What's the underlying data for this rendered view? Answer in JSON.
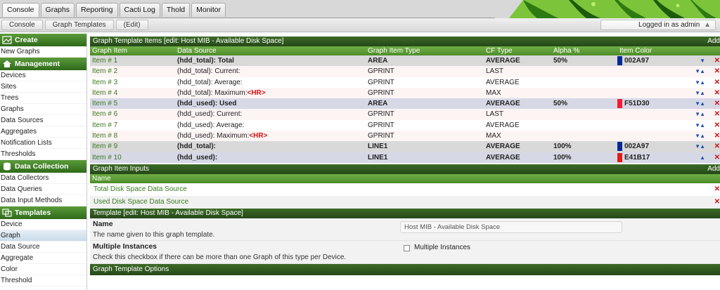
{
  "tabs": [
    "Console",
    "Graphs",
    "Reporting",
    "Cacti Log",
    "Thold",
    "Monitor"
  ],
  "breadcrumbs": [
    "Console",
    "Graph Templates",
    "(Edit)"
  ],
  "login_status": "Logged in as admin",
  "sidebar": {
    "create": {
      "label": "Create",
      "items": [
        "New Graphs"
      ]
    },
    "management": {
      "label": "Management",
      "items": [
        "Devices",
        "Sites",
        "Trees",
        "Graphs",
        "Data Sources",
        "Aggregates",
        "Notification Lists",
        "Thresholds"
      ]
    },
    "data_collection": {
      "label": "Data Collection",
      "items": [
        "Data Collectors",
        "Data Queries",
        "Data Input Methods"
      ]
    },
    "templates": {
      "label": "Templates",
      "items": [
        "Device",
        "Graph",
        "Data Source",
        "Aggregate",
        "Color",
        "Threshold"
      ],
      "selected": "Graph"
    }
  },
  "items_section": {
    "title": "Graph Template Items [edit: Host MIB - Available Disk Space]",
    "add_label": "Add",
    "columns": [
      "Graph Item",
      "Data Source",
      "Graph Item Type",
      "CF Type",
      "Alpha %",
      "Item Color"
    ],
    "rows": [
      {
        "name": "Item # 1",
        "ds": "(hdd_total): Total",
        "hr": "",
        "type": "AREA",
        "cf": "AVERAGE",
        "alpha": "50%",
        "color": "002A97",
        "hex": "#002A97",
        "arrows": "▼",
        "bold": true,
        "style": "hl2"
      },
      {
        "name": "Item # 2",
        "ds": "(hdd_total): Current:",
        "hr": "",
        "type": "GPRINT",
        "cf": "LAST",
        "alpha": "",
        "color": "",
        "hex": "",
        "arrows": "▼▲",
        "bold": false,
        "style": "even"
      },
      {
        "name": "Item # 3",
        "ds": "(hdd_total): Average:",
        "hr": "",
        "type": "GPRINT",
        "cf": "AVERAGE",
        "alpha": "",
        "color": "",
        "hex": "",
        "arrows": "▼▲",
        "bold": false,
        "style": "odd"
      },
      {
        "name": "Item # 4",
        "ds": "(hdd_total): Maximum:",
        "hr": "<HR>",
        "type": "GPRINT",
        "cf": "MAX",
        "alpha": "",
        "color": "",
        "hex": "",
        "arrows": "▼▲",
        "bold": false,
        "style": "even"
      },
      {
        "name": "Item # 5",
        "ds": "(hdd_used): Used",
        "hr": "",
        "type": "AREA",
        "cf": "AVERAGE",
        "alpha": "50%",
        "color": "F51D30",
        "hex": "#F51D30",
        "arrows": "▼▲",
        "bold": true,
        "style": "hl"
      },
      {
        "name": "Item # 6",
        "ds": "(hdd_used): Current:",
        "hr": "",
        "type": "GPRINT",
        "cf": "LAST",
        "alpha": "",
        "color": "",
        "hex": "",
        "arrows": "▼▲",
        "bold": false,
        "style": "even"
      },
      {
        "name": "Item # 7",
        "ds": "(hdd_used): Average:",
        "hr": "",
        "type": "GPRINT",
        "cf": "AVERAGE",
        "alpha": "",
        "color": "",
        "hex": "",
        "arrows": "▼▲",
        "bold": false,
        "style": "odd"
      },
      {
        "name": "Item # 8",
        "ds": "(hdd_used): Maximum:",
        "hr": "<HR>",
        "type": "GPRINT",
        "cf": "MAX",
        "alpha": "",
        "color": "",
        "hex": "",
        "arrows": "▼▲",
        "bold": false,
        "style": "even"
      },
      {
        "name": "Item # 9",
        "ds": "(hdd_total):",
        "hr": "",
        "type": "LINE1",
        "cf": "AVERAGE",
        "alpha": "100%",
        "color": "002A97",
        "hex": "#002A97",
        "arrows": "▼▲",
        "bold": true,
        "style": "hl2"
      },
      {
        "name": "Item # 10",
        "ds": "(hdd_used):",
        "hr": "",
        "type": "LINE1",
        "cf": "AVERAGE",
        "alpha": "100%",
        "color": "E41B17",
        "hex": "#E41B17",
        "arrows": "▲",
        "bold": true,
        "style": "hl"
      }
    ]
  },
  "inputs_section": {
    "title": "Graph Item Inputs",
    "add_label": "Add",
    "column": "Name",
    "rows": [
      "Total Disk Space Data Source",
      "Used Disk Space Data Source"
    ]
  },
  "template_section": {
    "title": "Template [edit: Host MIB - Available Disk Space]",
    "name_label": "Name",
    "name_desc": "The name given to this graph template.",
    "name_value": "Host MIB - Available Disk Space",
    "multi_label": "Multiple Instances",
    "multi_desc": "Check this checkbox if there can be more than one Graph of this type per Device.",
    "multi_checkbox_label": "Multiple Instances"
  },
  "options_section": {
    "title": "Graph Template Options"
  }
}
